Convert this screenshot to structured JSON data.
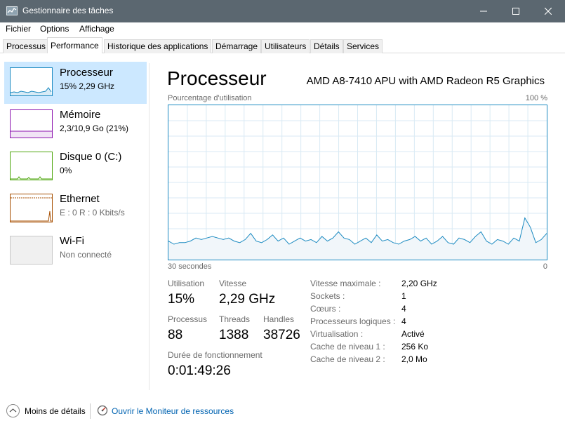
{
  "window": {
    "title": "Gestionnaire des tâches"
  },
  "menu": [
    "Fichier",
    "Options",
    "Affichage"
  ],
  "tabs": [
    "Processus",
    "Performance",
    "Historique des applications",
    "Démarrage",
    "Utilisateurs",
    "Détails",
    "Services"
  ],
  "sidebar": {
    "items": [
      {
        "name": "Processeur",
        "sub": "15% 2,29 GHz",
        "color": "#1b8ac1"
      },
      {
        "name": "Mémoire",
        "sub": "2,3/10,9 Go (21%)",
        "color": "#8b12ae"
      },
      {
        "name": "Disque 0 (C:)",
        "sub": "0%",
        "color": "#4da60c"
      },
      {
        "name": "Ethernet",
        "sub": "E : 0 R : 0 Kbits/s",
        "color": "#a74f01"
      },
      {
        "name": "Wi-Fi",
        "sub": "Non connecté",
        "color": "#c8c8c8"
      }
    ]
  },
  "main": {
    "title": "Processeur",
    "cpu_model": "AMD A8-7410 APU with AMD Radeon R5 Graphics",
    "graph_title": "Pourcentage d'utilisation",
    "graph_max": "100 %",
    "x_left": "30 secondes",
    "x_right": "0",
    "stats": {
      "utilisation_label": "Utilisation",
      "utilisation": "15%",
      "vitesse_label": "Vitesse",
      "vitesse": "2,29 GHz",
      "processus_label": "Processus",
      "processus": "88",
      "threads_label": "Threads",
      "threads": "1388",
      "handles_label": "Handles",
      "handles": "38726",
      "uptime_label": "Durée de fonctionnement",
      "uptime": "0:01:49:26"
    },
    "details": [
      {
        "label": "Vitesse maximale :",
        "value": "2,20 GHz"
      },
      {
        "label": "Sockets :",
        "value": "1"
      },
      {
        "label": "Cœurs :",
        "value": "4"
      },
      {
        "label": "Processeurs logiques :",
        "value": "4"
      },
      {
        "label": "Virtualisation :",
        "value": "Activé"
      },
      {
        "label": "Cache de niveau 1 :",
        "value": "256 Ko"
      },
      {
        "label": "Cache de niveau 2 :",
        "value": "2,0 Mo"
      }
    ]
  },
  "footer": {
    "less_details": "Moins de détails",
    "monitor_link": "Ouvrir le Moniteur de ressources"
  },
  "chart_data": {
    "type": "area",
    "xlabel": "",
    "ylabel": "Pourcentage d'utilisation",
    "ylim": [
      0,
      100
    ],
    "xlim": [
      30,
      0
    ],
    "values": [
      12,
      10,
      11,
      11,
      12,
      14,
      13,
      14,
      15,
      14,
      13,
      14,
      12,
      11,
      13,
      17,
      12,
      11,
      13,
      16,
      12,
      14,
      10,
      12,
      14,
      12,
      13,
      11,
      15,
      12,
      14,
      18,
      14,
      13,
      10,
      12,
      14,
      11,
      16,
      12,
      13,
      11,
      10,
      12,
      13,
      15,
      12,
      14,
      10,
      12,
      15,
      11,
      10,
      14,
      13,
      11,
      15,
      18,
      12,
      10,
      13,
      12,
      10,
      14,
      12,
      27,
      21,
      11,
      13,
      17
    ]
  }
}
